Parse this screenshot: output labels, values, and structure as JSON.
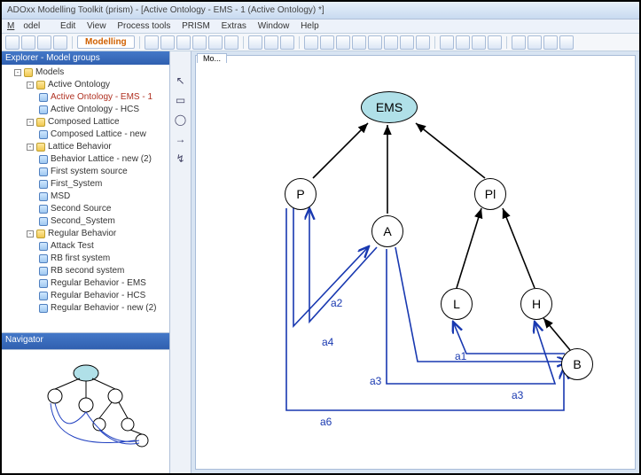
{
  "title": "ADOxx Modelling Toolkit (prism) - [Active Ontology - EMS - 1 (Active Ontology) *]",
  "menu": {
    "model": "Model",
    "edit": "Edit",
    "view": "View",
    "process": "Process tools",
    "prism": "PRISM",
    "extras": "Extras",
    "window": "Window",
    "help": "Help"
  },
  "modes": {
    "modelling": "Modelling"
  },
  "explorer": {
    "title": "Explorer - Model groups"
  },
  "navigator": {
    "title": "Navigator"
  },
  "canvasTab": "Mo...",
  "tree": {
    "root": "Models",
    "activeOntology": "Active Ontology",
    "ao_ems1": "Active Ontology - EMS - 1",
    "ao_hcs": "Active Ontology - HCS",
    "composed": "Composed Lattice",
    "cl_new": "Composed Lattice - new",
    "lattice": "Lattice Behavior",
    "bl_new2": "Behavior Lattice - new (2)",
    "fss": "First system source",
    "firstSys": "First_System",
    "msd": "MSD",
    "secondSource": "Second Source",
    "secondSys": "Second_System",
    "regular": "Regular Behavior",
    "attack": "Attack Test",
    "rb_first": "RB first system",
    "rb_second": "RB second system",
    "rb_ems": "Regular Behavior - EMS",
    "rb_hcs": "Regular Behavior - HCS",
    "rb_new2": "Regular Behavior - new (2)"
  },
  "nodes": {
    "ems": "EMS",
    "p": "P",
    "a": "A",
    "pl": "Pl",
    "l": "L",
    "h": "H",
    "b": "B"
  },
  "edges": {
    "a1": "a1",
    "a2": "a2",
    "a3": "a3",
    "a4": "a4",
    "a6": "a6"
  },
  "palette": {
    "cursor": "↖",
    "rect": "▭",
    "ellipse": "◯",
    "arrow": "→",
    "zig": "↯"
  }
}
